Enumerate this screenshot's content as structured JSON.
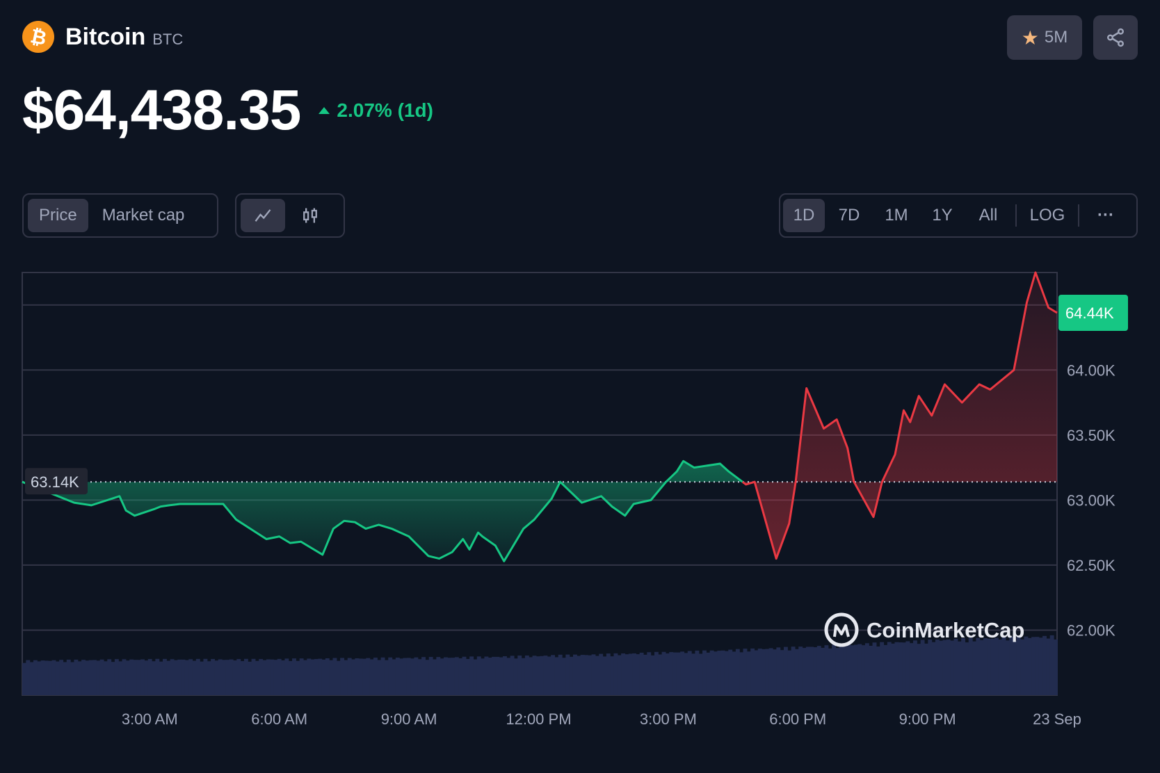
{
  "coin": {
    "name": "Bitcoin",
    "symbol": "BTC",
    "logo_glyph": "₿"
  },
  "actions": {
    "watchlist_count": "5M",
    "star_icon": "star-icon",
    "share_icon": "share-icon"
  },
  "price": {
    "value": "$64,438.35",
    "change": "2.07% (1d)",
    "direction": "up"
  },
  "controls": {
    "view_tabs": [
      {
        "label": "Price",
        "active": true
      },
      {
        "label": "Market cap",
        "active": false
      }
    ],
    "chart_type": [
      {
        "icon": "line-chart-icon",
        "active": true
      },
      {
        "icon": "candlestick-icon",
        "active": false
      }
    ],
    "ranges": [
      {
        "label": "1D",
        "active": true
      },
      {
        "label": "7D",
        "active": false
      },
      {
        "label": "1M",
        "active": false
      },
      {
        "label": "1Y",
        "active": false
      },
      {
        "label": "All",
        "active": false
      }
    ],
    "log_label": "LOG",
    "more_label": "···"
  },
  "colors": {
    "up": "#16c784",
    "down": "#ea3943",
    "background": "#0d1421",
    "panel": "#323546",
    "volume": "#222c4f"
  },
  "chart_data": {
    "type": "line",
    "baseline": 63.14,
    "baseline_label": "63.14K",
    "current_label": "64.44K",
    "ylim": [
      61.5,
      64.75
    ],
    "y_ticks": [
      62.0,
      62.5,
      63.0,
      63.5,
      64.0
    ],
    "y_tick_labels": [
      "62.00K",
      "62.50K",
      "63.00K",
      "63.50K",
      "64.00K"
    ],
    "x_tick_labels": [
      "3:00 AM",
      "6:00 AM",
      "9:00 AM",
      "12:00 PM",
      "3:00 PM",
      "6:00 PM",
      "9:00 PM",
      "23 Sep"
    ],
    "x_tick_hours": [
      3,
      6,
      9,
      12,
      15,
      18,
      21,
      24
    ],
    "x_range_hours": [
      0.05,
      24
    ],
    "series": [
      {
        "x_hours": [
          0.05,
          1.25,
          1.65,
          2.3,
          2.45,
          2.65,
          3.1,
          3.25,
          3.45,
          3.7,
          4.7,
          5.0,
          5.7,
          6.0,
          6.25,
          6.5,
          7.0,
          7.25,
          7.5,
          7.75,
          8.0,
          8.3,
          8.6,
          9.0,
          9.45,
          9.7,
          10.0,
          10.25,
          10.4,
          10.6,
          10.7,
          11.0,
          11.2,
          11.65,
          11.9,
          12.3,
          12.5,
          13.0,
          13.45,
          13.7,
          14.0,
          14.2,
          14.6,
          14.95,
          15.2,
          15.35,
          15.6,
          16.2,
          16.4,
          16.8,
          17.0,
          17.5,
          17.8,
          17.95,
          18.2,
          18.6,
          18.9,
          19.15,
          19.3,
          19.75,
          19.95,
          20.25,
          20.45,
          20.6,
          20.8,
          21.1,
          21.4,
          21.8,
          22.2,
          22.45,
          23.0,
          23.3,
          23.5,
          23.8,
          24.0
        ],
        "y": [
          63.14,
          62.98,
          62.96,
          63.03,
          62.92,
          62.88,
          62.93,
          62.95,
          62.96,
          62.97,
          62.97,
          62.85,
          62.7,
          62.72,
          62.67,
          62.68,
          62.58,
          62.78,
          62.84,
          62.83,
          62.78,
          62.81,
          62.78,
          62.72,
          62.57,
          62.55,
          62.6,
          62.7,
          62.62,
          62.75,
          62.72,
          62.65,
          62.53,
          62.78,
          62.85,
          63.01,
          63.14,
          62.98,
          63.03,
          62.95,
          62.88,
          62.97,
          63.0,
          63.14,
          63.22,
          63.3,
          63.25,
          63.28,
          63.22,
          63.12,
          63.14,
          62.55,
          62.82,
          63.14,
          63.86,
          63.55,
          63.62,
          63.4,
          63.14,
          62.87,
          63.14,
          63.35,
          63.69,
          63.6,
          63.8,
          63.65,
          63.89,
          63.75,
          63.89,
          63.85,
          64.0,
          64.52,
          64.75,
          64.48,
          64.44
        ]
      }
    ],
    "volume_relative": [
      0.28,
      0.29,
      0.29,
      0.3,
      0.31,
      0.33,
      0.36,
      0.4,
      0.45,
      0.48
    ]
  },
  "watermark": {
    "text": "CoinMarketCap"
  }
}
